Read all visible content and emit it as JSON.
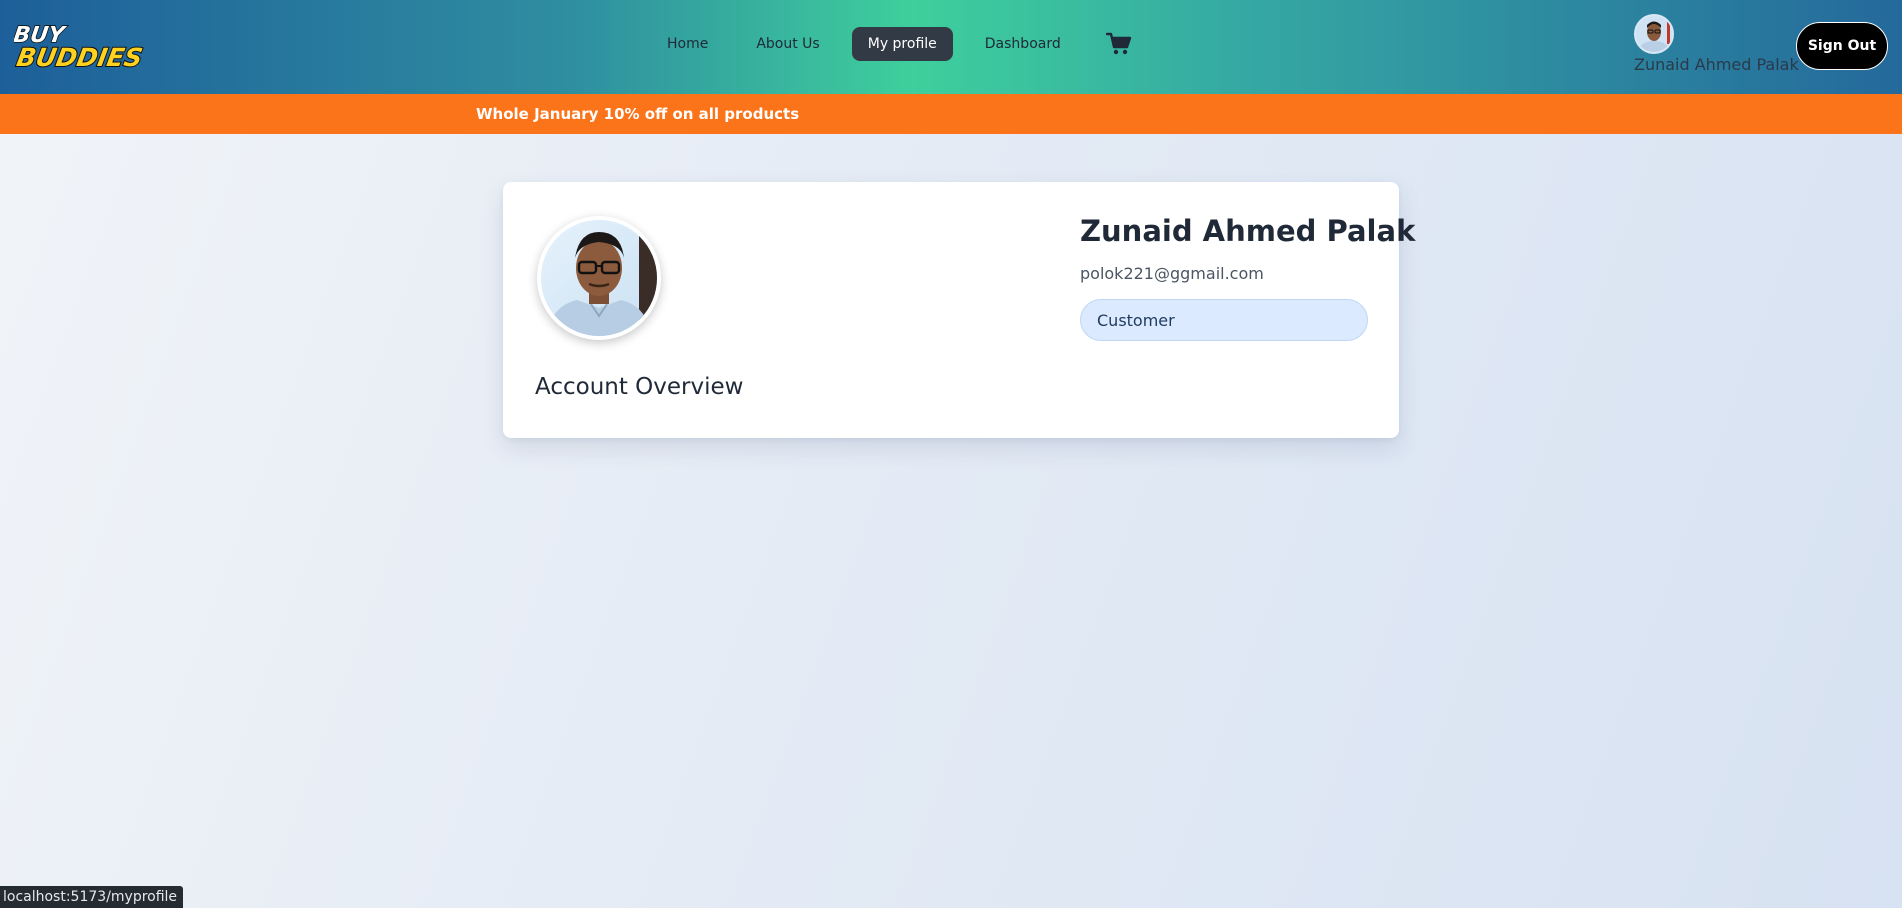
{
  "brand": {
    "logo_line1": "BUY",
    "logo_line2": "BUDDIES",
    "logo_colors": {
      "line1": "#ffffff",
      "line2": "#ffd21f",
      "outline": "#111111"
    }
  },
  "nav": {
    "links": [
      {
        "label": "Home",
        "active": false
      },
      {
        "label": "About Us",
        "active": false
      },
      {
        "label": "My profile",
        "active": true
      },
      {
        "label": "Dashboard",
        "active": false
      }
    ],
    "cart_icon": "shopping-cart-icon",
    "user": {
      "name": "Zunaid Ahmed Palak",
      "avatar_icon": "user-avatar"
    },
    "signout_label": "Sign Out"
  },
  "promo": {
    "text": "Whole January 10% off on all products",
    "color": "#fb741a"
  },
  "profile": {
    "name": "Zunaid Ahmed Palak",
    "email": "polok221@ggmail.com",
    "role": "Customer",
    "section_title": "Account Overview"
  },
  "status_bar": {
    "url": "localhost:5173/myprofile"
  },
  "colors": {
    "nav_gradient": [
      "#1d5f9a",
      "#3ecf9c",
      "#24699c"
    ],
    "active_tab": "#323a46",
    "badge_bg": "#dbeafe"
  }
}
